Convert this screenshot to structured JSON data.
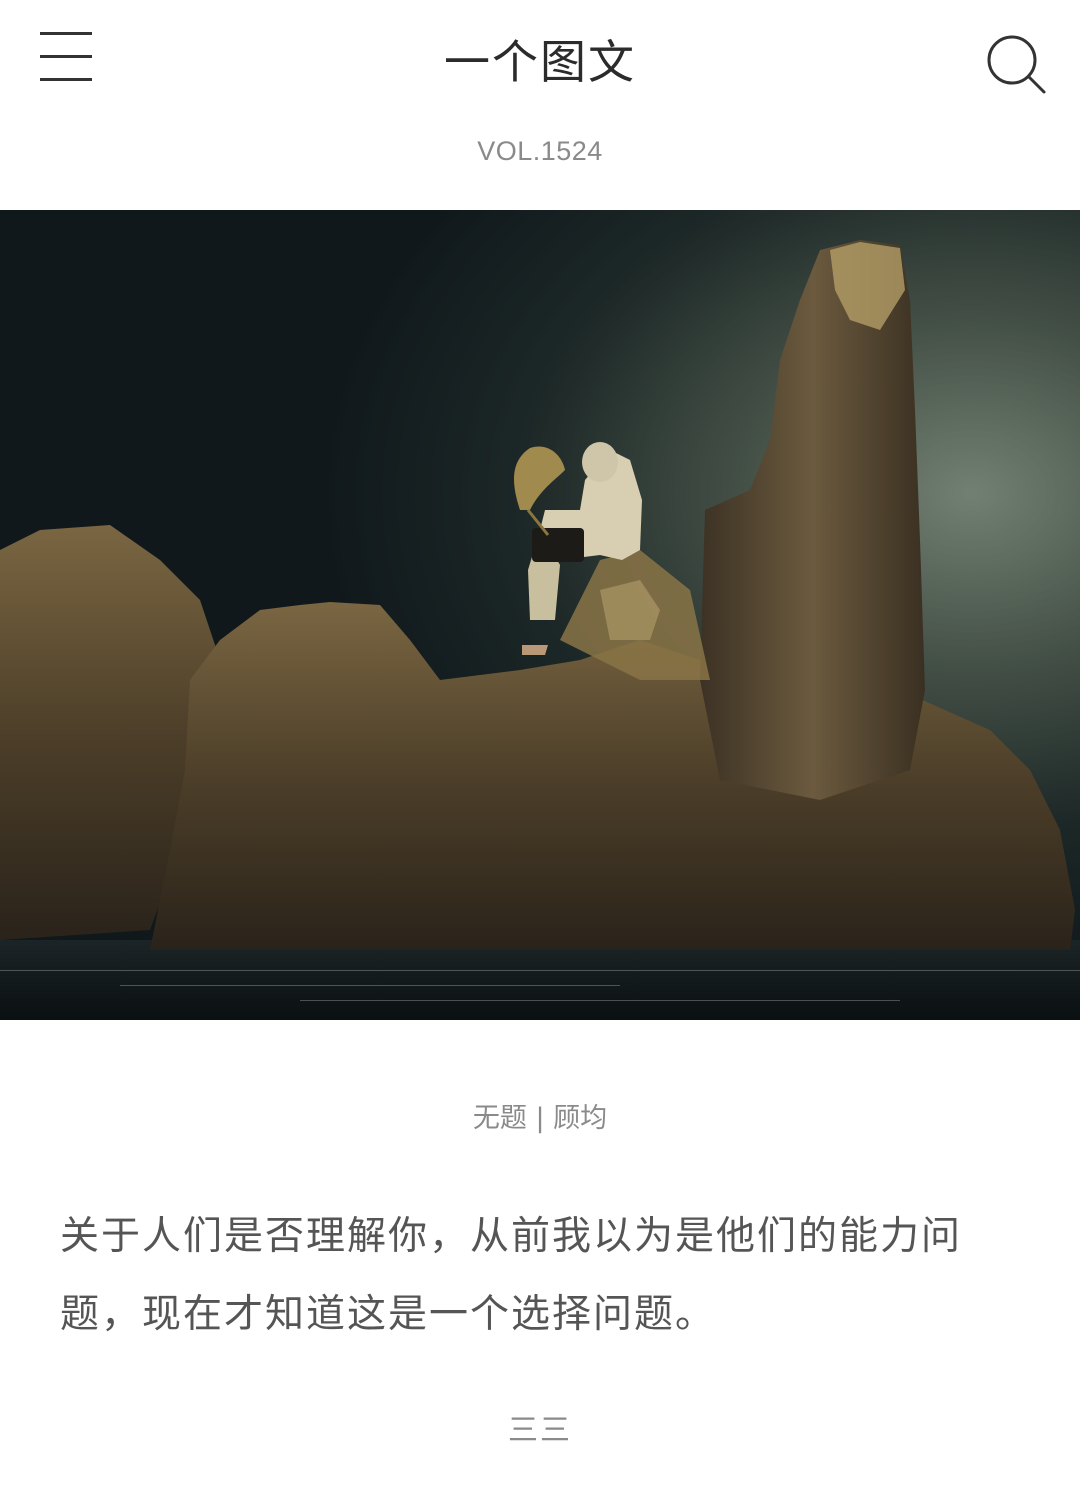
{
  "header": {
    "title": "一个图文",
    "menu_icon": "menu-icon",
    "search_icon": "search-icon"
  },
  "issue": {
    "vol": "VOL.1524"
  },
  "hero_image": {
    "description_icon": "photo",
    "colors": {
      "sky_dark": "#141c1f",
      "sky_light": "#8f9f8c",
      "rock": "#5a4a32",
      "water": "#0e1416"
    }
  },
  "caption": {
    "text": "无题 | 顾均"
  },
  "quote": {
    "text": "关于人们是否理解你，从前我以为是他们的能力问题，现在才知道这是一个选择问题。"
  },
  "author": {
    "name": "三三"
  },
  "colors": {
    "title": "#2b2b2b",
    "muted": "#8a8a8a",
    "body_text": "#555555",
    "background": "#ffffff"
  }
}
